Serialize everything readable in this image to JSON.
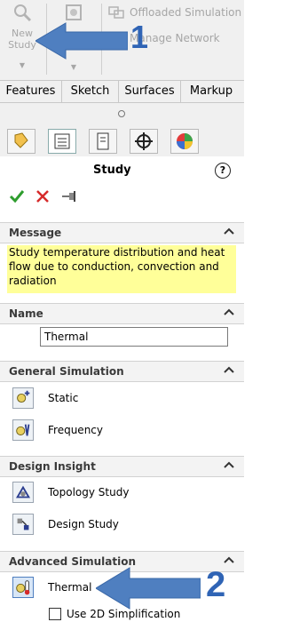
{
  "toolbar": {
    "new_study_label": "New\nStudy",
    "offloaded_label": "Offloaded Simulation",
    "manage_label": "Manage Network",
    "annotation_1": "1"
  },
  "tabs": [
    "Features",
    "Sketch",
    "Surfaces",
    "Markup"
  ],
  "panel": {
    "title": "Study",
    "help_glyph": "?"
  },
  "message": {
    "header": "Message",
    "text": "Study temperature distribution and heat flow due to conduction, convection and radiation"
  },
  "name": {
    "header": "Name",
    "value": "Thermal"
  },
  "general_simulation": {
    "header": "General Simulation",
    "items": [
      {
        "label": "Static",
        "icon": "static-study-icon"
      },
      {
        "label": "Frequency",
        "icon": "frequency-study-icon"
      }
    ]
  },
  "design_insight": {
    "header": "Design Insight",
    "items": [
      {
        "label": "Topology Study",
        "icon": "topology-study-icon"
      },
      {
        "label": "Design Study",
        "icon": "design-study-icon"
      }
    ]
  },
  "advanced_simulation": {
    "header": "Advanced Simulation",
    "items": [
      {
        "label": "Thermal",
        "icon": "thermal-study-icon"
      }
    ],
    "checkbox_label": "Use 2D Simplification",
    "annotation_2": "2"
  },
  "colors": {
    "message_bg": "#ffff99",
    "accept": "#2e9d2e",
    "cancel": "#d62a2a",
    "annotation_arrow": "#4f7fc0",
    "annotation_number": "#2f64b5"
  }
}
